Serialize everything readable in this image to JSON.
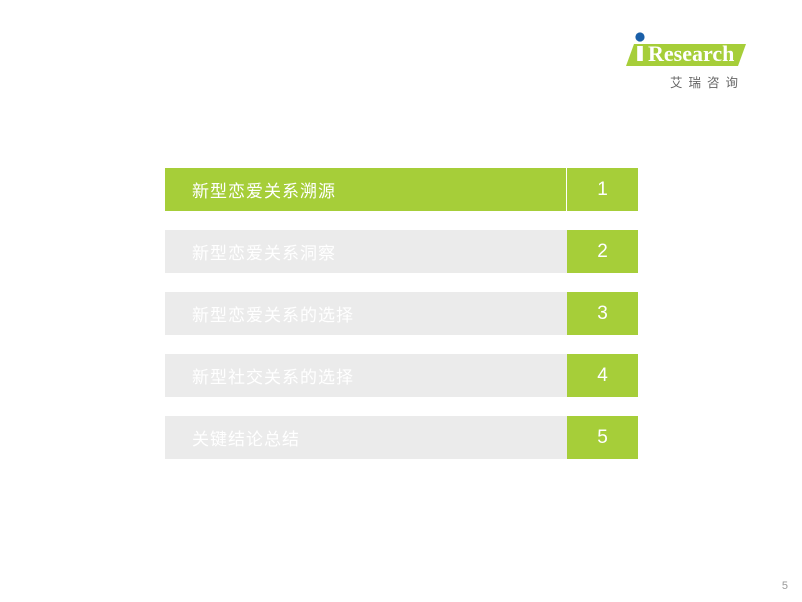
{
  "logo": {
    "letter_i": "i",
    "wordmark": "Research",
    "chinese_sub": "艾瑞咨询"
  },
  "agenda": {
    "items": [
      {
        "title": "新型恋爱关系溯源",
        "number": "1",
        "state": "active"
      },
      {
        "title": "新型恋爱关系洞察",
        "number": "2",
        "state": "inactive"
      },
      {
        "title": "新型恋爱关系的选择",
        "number": "3",
        "state": "inactive"
      },
      {
        "title": "新型社交关系的选择",
        "number": "4",
        "state": "inactive"
      },
      {
        "title": "关键结论总结",
        "number": "5",
        "state": "inactive"
      }
    ]
  },
  "footer": {
    "page_number": "5"
  },
  "colors": {
    "accent_green": "#a6ce39",
    "inactive_gray": "#ebebeb",
    "logo_blue": "#1a5fa8",
    "text_gray": "#666666"
  }
}
